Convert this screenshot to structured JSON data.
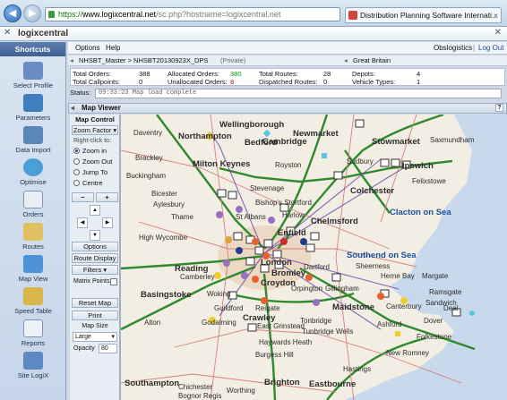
{
  "browser": {
    "https": "https://",
    "host": "www.logixcentral.net",
    "url_rest": "/sc.php?hostname=logixcentral.net",
    "tab_title": "Distribution Planning Software Internati..."
  },
  "app": {
    "brand": "logixcentral"
  },
  "sidebar": {
    "title": "Shortcuts",
    "items": [
      {
        "label": "Select Profile",
        "icon": "profile-icon"
      },
      {
        "label": "Parameters",
        "icon": "parameters-icon"
      },
      {
        "label": "Data Import",
        "icon": "data-import-icon"
      },
      {
        "label": "Optimise",
        "icon": "optimise-icon"
      },
      {
        "label": "Orders",
        "icon": "orders-icon"
      },
      {
        "label": "Routes",
        "icon": "routes-icon"
      },
      {
        "label": "Map View",
        "icon": "map-view-icon"
      },
      {
        "label": "Speed Table",
        "icon": "speed-table-icon"
      },
      {
        "label": "Reports",
        "icon": "reports-icon"
      },
      {
        "label": "Site LogiX",
        "icon": "site-logix-icon"
      }
    ]
  },
  "menu": {
    "options": "Options",
    "help": "Help",
    "user": "Obslogistics",
    "logout": "Log Out"
  },
  "crumb": {
    "path": "NHSBT_Master > NHSBT20130923X_DPS",
    "private": "(Private)",
    "region": "Great Britain"
  },
  "stats": {
    "total_orders_label": "Total Orders:",
    "total_orders": "388",
    "total_callpoints_label": "Total Callpoints:",
    "total_callpoints": "0",
    "allocated_label": "Allocated Orders:",
    "allocated": "380",
    "unallocated_label": "Unallocated Orders:",
    "unallocated": "8",
    "total_routes_label": "Total Routes:",
    "total_routes": "28",
    "dispatched_label": "Dispatched Routes:",
    "dispatched": "0",
    "depots_label": "Depots:",
    "depots": "4",
    "vehicle_types_label": "Vehicle Types:",
    "vehicle_types": "1"
  },
  "status": {
    "label": "Status:",
    "text": "09:33:23 Map load complete"
  },
  "map_viewer": {
    "title": "Map Viewer",
    "help": "?"
  },
  "map_control": {
    "title": "Map Control",
    "zoom_factor": "Zoom Factor",
    "right_click": "Right-click to:",
    "zoom_in": "Zoom in",
    "zoom_out": "Zoom Out",
    "jump_to": "Jump To",
    "centre": "Centre",
    "minus": "−",
    "plus": "+",
    "options": "Options",
    "route_display": "Route Display",
    "filters": "Filters",
    "matrix_points": "Matrix Points",
    "reset_map": "Reset Map",
    "print": "Print",
    "map_size": "Map Size",
    "map_size_value": "Large",
    "opacity_label": "Opacity",
    "opacity_value": "80"
  },
  "map_labels": {
    "wellingborough": "Wellingborough",
    "daventry": "Daventry",
    "northampton": "Northampton",
    "newmarket": "Newmarket",
    "stowmarket": "Stowmarket",
    "saxmundham": "Saxmundham",
    "bedford": "Bedford",
    "cambridge": "Cambridge",
    "brackley": "Brackley",
    "milton_keynes": "Milton Keynes",
    "royston": "Royston",
    "sudbury": "Sudbury",
    "ipswich": "Ipswich",
    "buckingham": "Buckingham",
    "bicester": "Bicester",
    "stevenage": "Stevenage",
    "colchester": "Colchester",
    "felixstowe": "Felixstowe",
    "aylesbury": "Aylesbury",
    "bishops_stortford": "Bishop's Stortford",
    "harlow": "Harlow",
    "clacton": "Clacton on Sea",
    "thame": "Thame",
    "st_albans": "St Albans",
    "chelmsford": "Chelmsford",
    "high_wycombe": "High Wycombe",
    "enfield": "Enfield",
    "southend": "Southend on Sea",
    "reading": "Reading",
    "london": "London",
    "dartford": "Dartford",
    "sheerness": "Sheerness",
    "herne_bay": "Herne Bay",
    "margate": "Margate",
    "bromley": "Bromley",
    "camberley": "Camberley",
    "croydon": "Croydon",
    "orpington": "Orpington",
    "basingstoke": "Basingstoke",
    "gillingham": "Gillingham",
    "woking": "Woking",
    "maidstone": "Maidstone",
    "ramsgate": "Ramsgate",
    "guildford": "Guildford",
    "canterbury": "Canterbury",
    "sandwich": "Sandwich",
    "deal": "Deal",
    "reigate": "Reigate",
    "tonbridge": "Tonbridge",
    "ashford": "Ashford",
    "dover": "Dover",
    "east_grinstead": "East Grinstead",
    "tunbridge_wells": "Tunbridge Wells",
    "crawley": "Crawley",
    "godalming": "Godalming",
    "alton": "Alton",
    "folkestone": "Folkestone",
    "haywards_heath": "Haywards Heath",
    "new_romney": "New Romney",
    "burgess_hill": "Burgess Hill",
    "hastings": "Hastings",
    "southampton": "Southampton",
    "brighton": "Brighton",
    "eastbourne": "Eastbourne",
    "chichester": "Chichester",
    "worthing": "Worthing",
    "bognor": "Bognor Regis"
  }
}
